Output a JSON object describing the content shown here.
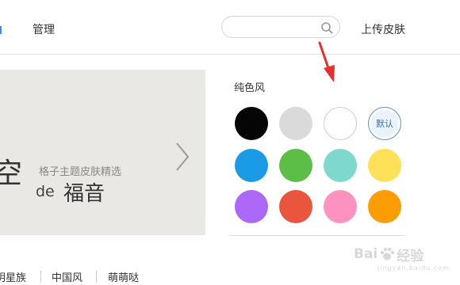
{
  "header": {
    "manage_label": "管理",
    "search_placeholder": "",
    "upload_label": "上传皮肤"
  },
  "banner": {
    "big_text": "空",
    "sub_text": "格子主题皮肤精选",
    "de_text": "de",
    "main_text": "福音"
  },
  "panel": {
    "title": "纯色风",
    "default_label": "默认",
    "swatches": [
      {
        "name": "black",
        "color": "#050505"
      },
      {
        "name": "light-gray",
        "color": "#dadada"
      },
      {
        "name": "white",
        "color": "#ffffff"
      },
      {
        "name": "default",
        "color": "#eaf2fc"
      },
      {
        "name": "blue",
        "color": "#1b9ae6"
      },
      {
        "name": "green",
        "color": "#5cbd47"
      },
      {
        "name": "teal",
        "color": "#7fd8ce"
      },
      {
        "name": "yellow",
        "color": "#fee059"
      },
      {
        "name": "purple",
        "color": "#ac68f7"
      },
      {
        "name": "red",
        "color": "#ea553d"
      },
      {
        "name": "pink",
        "color": "#fb93be"
      },
      {
        "name": "orange",
        "color": "#fc9d06"
      }
    ]
  },
  "categories": [
    "明星族",
    "中国风",
    "萌萌哒"
  ],
  "watermark": {
    "text": "Bai",
    "text2": "经验",
    "sub": "jingyan.baidu.com"
  },
  "colors": {
    "accent": "#3b8cf0",
    "arrow": "#e5322d"
  }
}
